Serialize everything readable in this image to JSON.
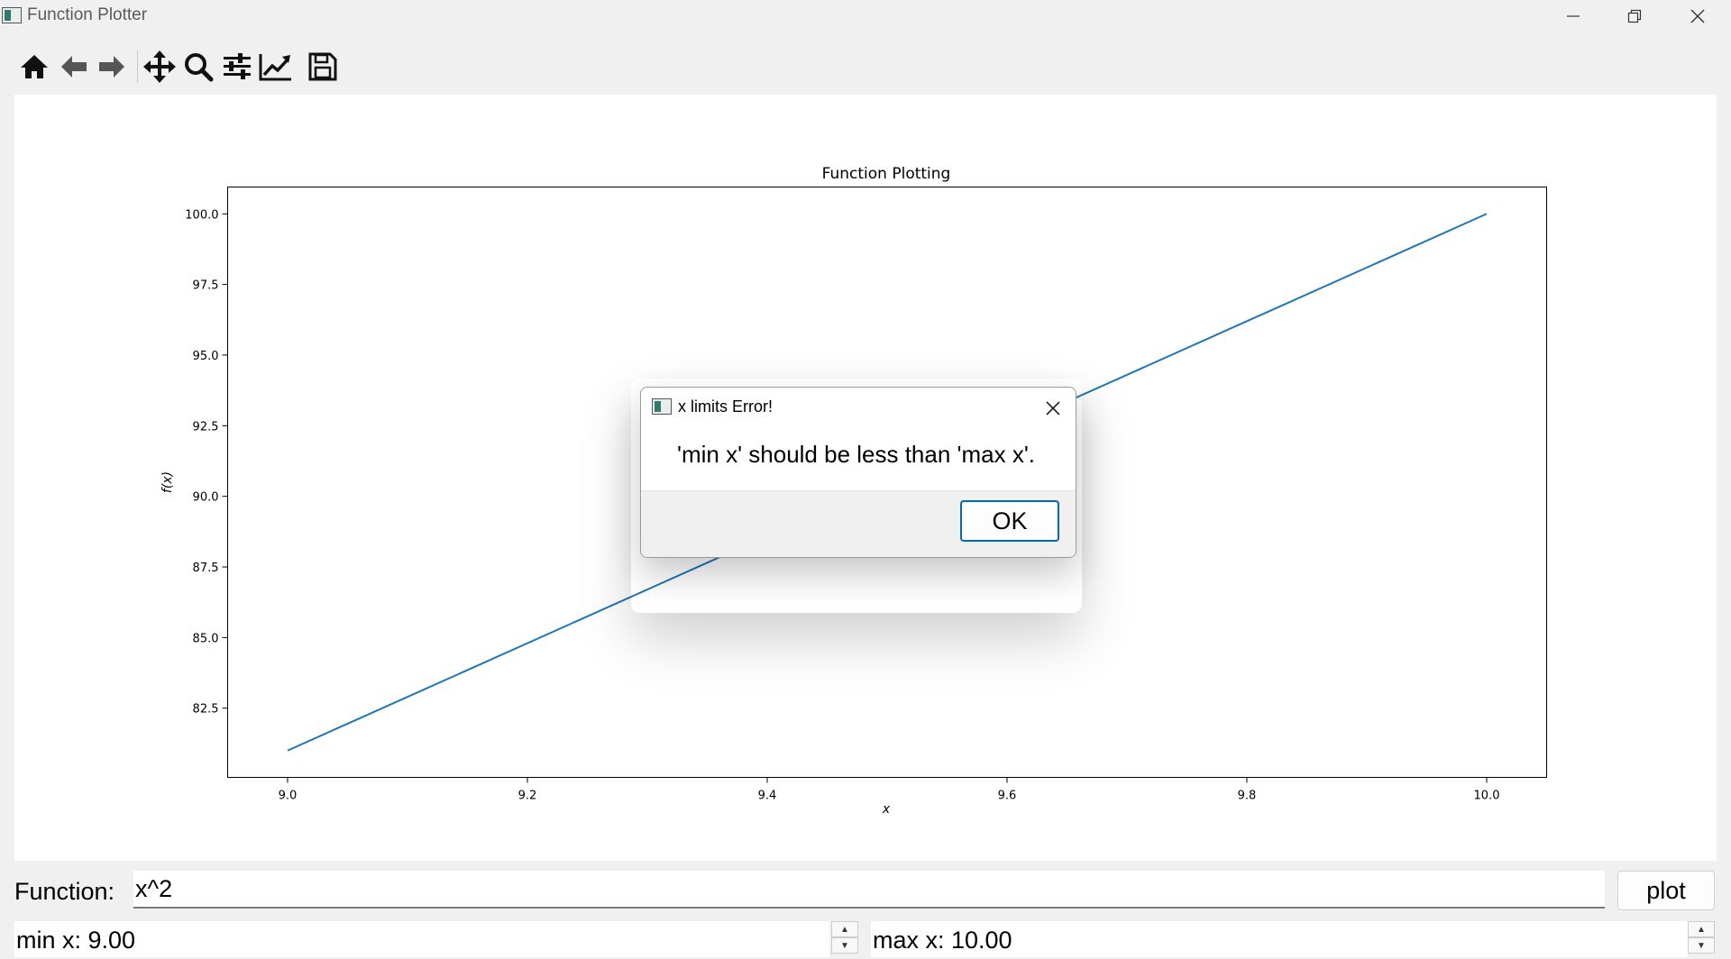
{
  "window": {
    "title": "Function Plotter"
  },
  "toolbar": {
    "buttons": [
      {
        "name": "home-icon"
      },
      {
        "name": "back-arrow-icon"
      },
      {
        "name": "forward-arrow-icon"
      },
      {
        "name": "pan-move-icon"
      },
      {
        "name": "zoom-magnifier-icon"
      },
      {
        "name": "configure-subplots-icon"
      },
      {
        "name": "edit-axes-icon"
      },
      {
        "name": "save-floppy-icon"
      }
    ]
  },
  "chart_data": {
    "type": "line",
    "title": "Function Plotting",
    "xlabel": "x",
    "ylabel": "f(x)",
    "xlim": [
      8.95,
      10.05
    ],
    "ylim": [
      80.05,
      100.95
    ],
    "xticks": [
      "9.0",
      "9.2",
      "9.4",
      "9.6",
      "9.8",
      "10.0"
    ],
    "yticks": [
      "82.5",
      "85.0",
      "87.5",
      "90.0",
      "92.5",
      "95.0",
      "97.5",
      "100.0"
    ],
    "x": [
      9.0,
      10.0
    ],
    "y": [
      81.0,
      100.0
    ],
    "color": "#1f77b4",
    "grid": false
  },
  "form": {
    "function_label": "Function:",
    "function_value": "x^2",
    "plot_button": "plot",
    "min_x": "min x: 9.00",
    "max_x": "max x: 10.00"
  },
  "dialog": {
    "title": "x limits Error!",
    "message": "'min x' should be less than 'max x'.",
    "ok_label": "OK"
  },
  "colors": {
    "line": "#1f77b4",
    "focus_border": "#0067c0"
  }
}
